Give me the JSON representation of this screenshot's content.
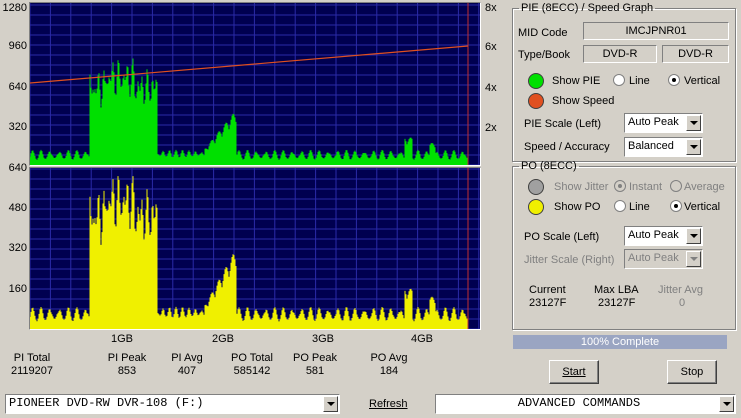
{
  "pie_graph": {
    "y_labels": [
      "1280",
      "960",
      "640",
      "320"
    ],
    "speed_labels": [
      "8x",
      "6x",
      "4x",
      "2x"
    ]
  },
  "po_graph": {
    "y_labels": [
      "640",
      "480",
      "320",
      "160"
    ]
  },
  "x_labels": [
    "1GB",
    "2GB",
    "3GB",
    "4GB"
  ],
  "stats": [
    {
      "label": "PI Total",
      "value": "2119207"
    },
    {
      "label": "PI Peak",
      "value": "853"
    },
    {
      "label": "PI Avg",
      "value": "407"
    },
    {
      "label": "PO Total",
      "value": "585142"
    },
    {
      "label": "PO Peak",
      "value": "581"
    },
    {
      "label": "PO Avg",
      "value": "184"
    }
  ],
  "pie_panel": {
    "title": "PIE (8ECC) / Speed Graph",
    "mid_code_label": "MID Code",
    "mid_code": "IMCJPNR01",
    "type_book_label": "Type/Book",
    "type": "DVD-R",
    "book": "DVD-R",
    "show_pie": "Show PIE",
    "show_speed": "Show Speed",
    "line": "Line",
    "vertical": "Vertical",
    "scale_label": "PIE Scale (Left)",
    "scale_value": "Auto Peak",
    "speed_label": "Speed / Accuracy",
    "speed_value": "Balanced",
    "pie_color": "#00e000",
    "speed_color": "#e05020"
  },
  "po_panel": {
    "title": "PO (8ECC)",
    "show_jitter": "Show Jitter",
    "instant": "Instant",
    "average": "Average",
    "show_po": "Show PO",
    "line": "Line",
    "vertical": "Vertical",
    "scale_label": "PO Scale (Left)",
    "scale_value": "Auto Peak",
    "jitter_label": "Jitter Scale (Right)",
    "jitter_value": "Auto Peak",
    "current_label": "Current",
    "current_value": "23127F",
    "maxlba_label": "Max LBA",
    "maxlba_value": "23127F",
    "jitter_avg_label": "Jitter Avg",
    "jitter_avg_value": "0",
    "po_color": "#f0f000",
    "jitter_color": "#a0a0a0"
  },
  "progress": {
    "text": "100% Complete",
    "fraction": 1.0
  },
  "buttons": {
    "start": "Start",
    "stop": "Stop",
    "refresh": "Refresh"
  },
  "drive": "PIONEER DVD-RW  DVR-108  (F:)",
  "advanced": "ADVANCED COMMANDS"
}
